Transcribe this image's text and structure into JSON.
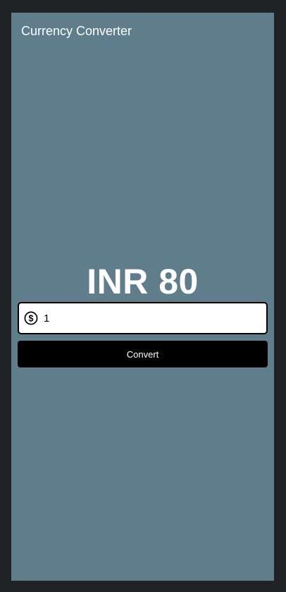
{
  "appbar": {
    "title": "Currency Converter"
  },
  "result": {
    "text": "INR 80"
  },
  "amount_input": {
    "value": "1",
    "placeholder": "",
    "icon": "dollar-circle-icon"
  },
  "convert_button": {
    "label": "Convert"
  },
  "colors": {
    "background": "#607d8b",
    "outer": "#202124",
    "button": "#000000",
    "text_light": "#ffffff"
  }
}
